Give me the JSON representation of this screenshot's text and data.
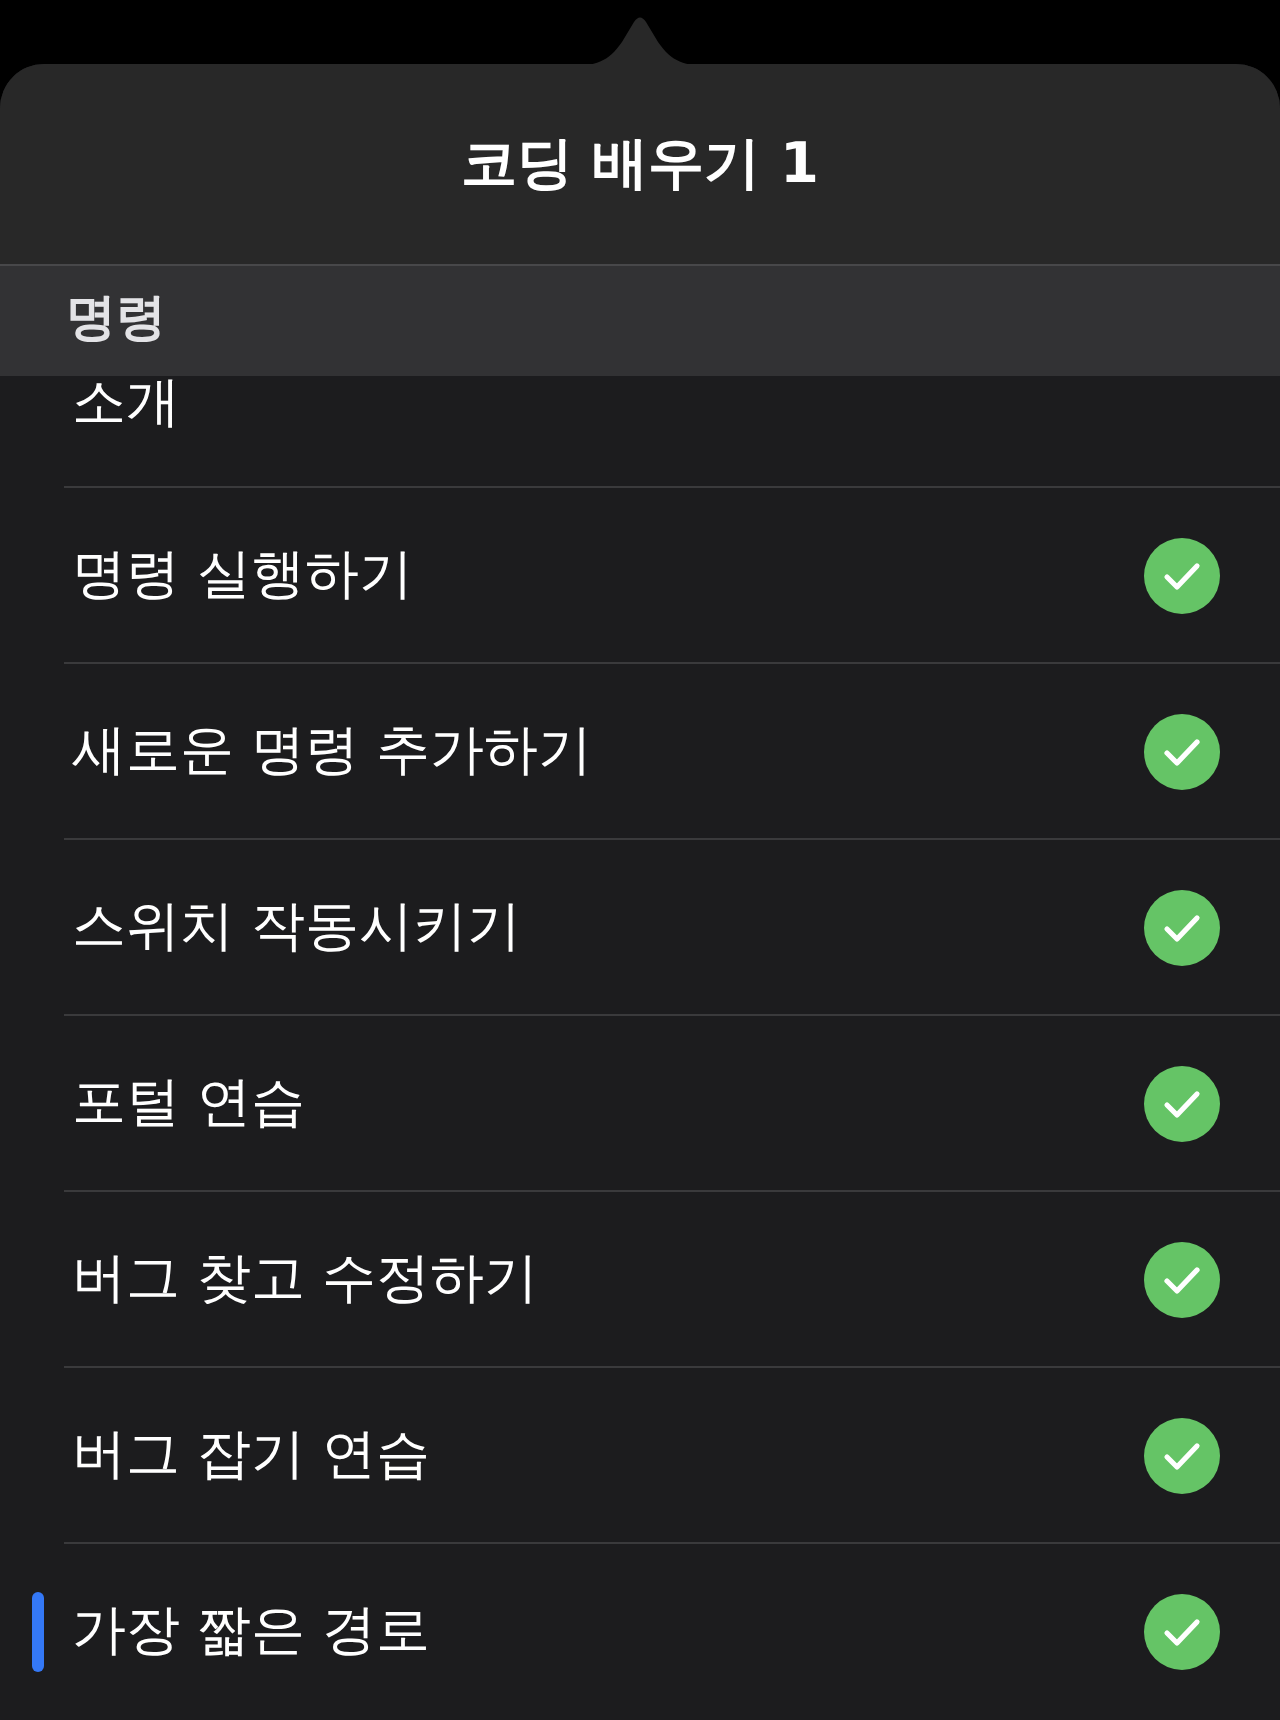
{
  "popover": {
    "title": "코딩 배우기 1"
  },
  "section": {
    "title": "명령"
  },
  "lessons": [
    {
      "title": "소개",
      "completed": false,
      "selected": false
    },
    {
      "title": "명령 실행하기",
      "completed": true,
      "selected": false
    },
    {
      "title": "새로운 명령 추가하기",
      "completed": true,
      "selected": false
    },
    {
      "title": "스위치 작동시키기",
      "completed": true,
      "selected": false
    },
    {
      "title": "포털 연습",
      "completed": true,
      "selected": false
    },
    {
      "title": "버그 찾고 수정하기",
      "completed": true,
      "selected": false
    },
    {
      "title": "버그 잡기 연습",
      "completed": true,
      "selected": false
    },
    {
      "title": "가장 짧은 경로",
      "completed": true,
      "selected": true
    }
  ]
}
